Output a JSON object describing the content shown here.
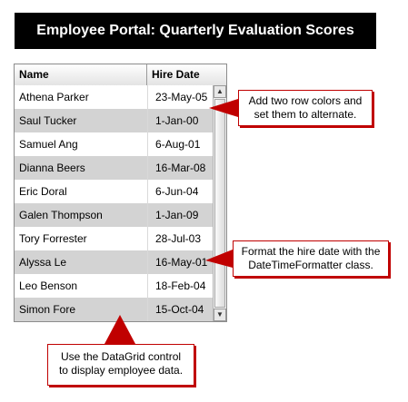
{
  "title": "Employee Portal: Quarterly Evaluation Scores",
  "grid": {
    "headers": {
      "name": "Name",
      "hire_date": "Hire Date"
    },
    "rows": [
      {
        "name": "Athena Parker",
        "hire_date": "23-May-05"
      },
      {
        "name": "Saul Tucker",
        "hire_date": "1-Jan-00"
      },
      {
        "name": "Samuel Ang",
        "hire_date": "6-Aug-01"
      },
      {
        "name": "Dianna Beers",
        "hire_date": "16-Mar-08"
      },
      {
        "name": "Eric Doral",
        "hire_date": "6-Jun-04"
      },
      {
        "name": "Galen Thompson",
        "hire_date": "1-Jan-09"
      },
      {
        "name": "Tory Forrester",
        "hire_date": "28-Jul-03"
      },
      {
        "name": "Alyssa Le",
        "hire_date": "16-May-01"
      },
      {
        "name": "Leo Benson",
        "hire_date": "18-Feb-04"
      },
      {
        "name": "Simon Fore",
        "hire_date": "15-Oct-04"
      }
    ],
    "row_colors": [
      "#ffffff",
      "#d3d3d3"
    ]
  },
  "callouts": {
    "row_colors": {
      "line1": "Add two row colors and",
      "line2": "set them to alternate."
    },
    "hire_date": {
      "line1": "Format the hire date with the",
      "line2": "DateTimeFormatter class."
    },
    "datagrid": {
      "line1": "Use the DataGrid control",
      "line2": "to display employee data."
    }
  },
  "colors": {
    "accent": "#c00000",
    "title_bg": "#000000"
  }
}
